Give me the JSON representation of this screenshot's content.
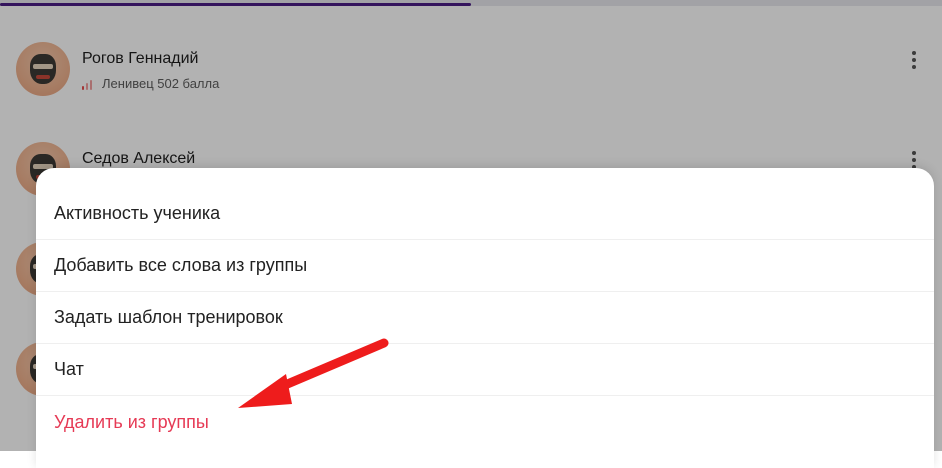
{
  "progress": {
    "fraction": 0.5
  },
  "students": [
    {
      "name": "Рогов Геннадий",
      "status": "Ленивец 502 балла"
    },
    {
      "name": "Седов Алексей",
      "status": ""
    },
    {
      "name": "",
      "status": ""
    },
    {
      "name": "",
      "status": ""
    }
  ],
  "menu": {
    "items": [
      {
        "label": "Активность ученика"
      },
      {
        "label": "Добавить все слова из группы"
      },
      {
        "label": "Задать шаблон тренировок"
      },
      {
        "label": "Чат"
      },
      {
        "label": "Удалить из группы",
        "danger": true
      }
    ]
  },
  "colors": {
    "accent": "#4b1e86",
    "danger": "#e63a55",
    "annotation_arrow": "#ee1c1c"
  },
  "icons": {
    "status": "signal-bars-icon",
    "more": "more-vertical-icon"
  }
}
